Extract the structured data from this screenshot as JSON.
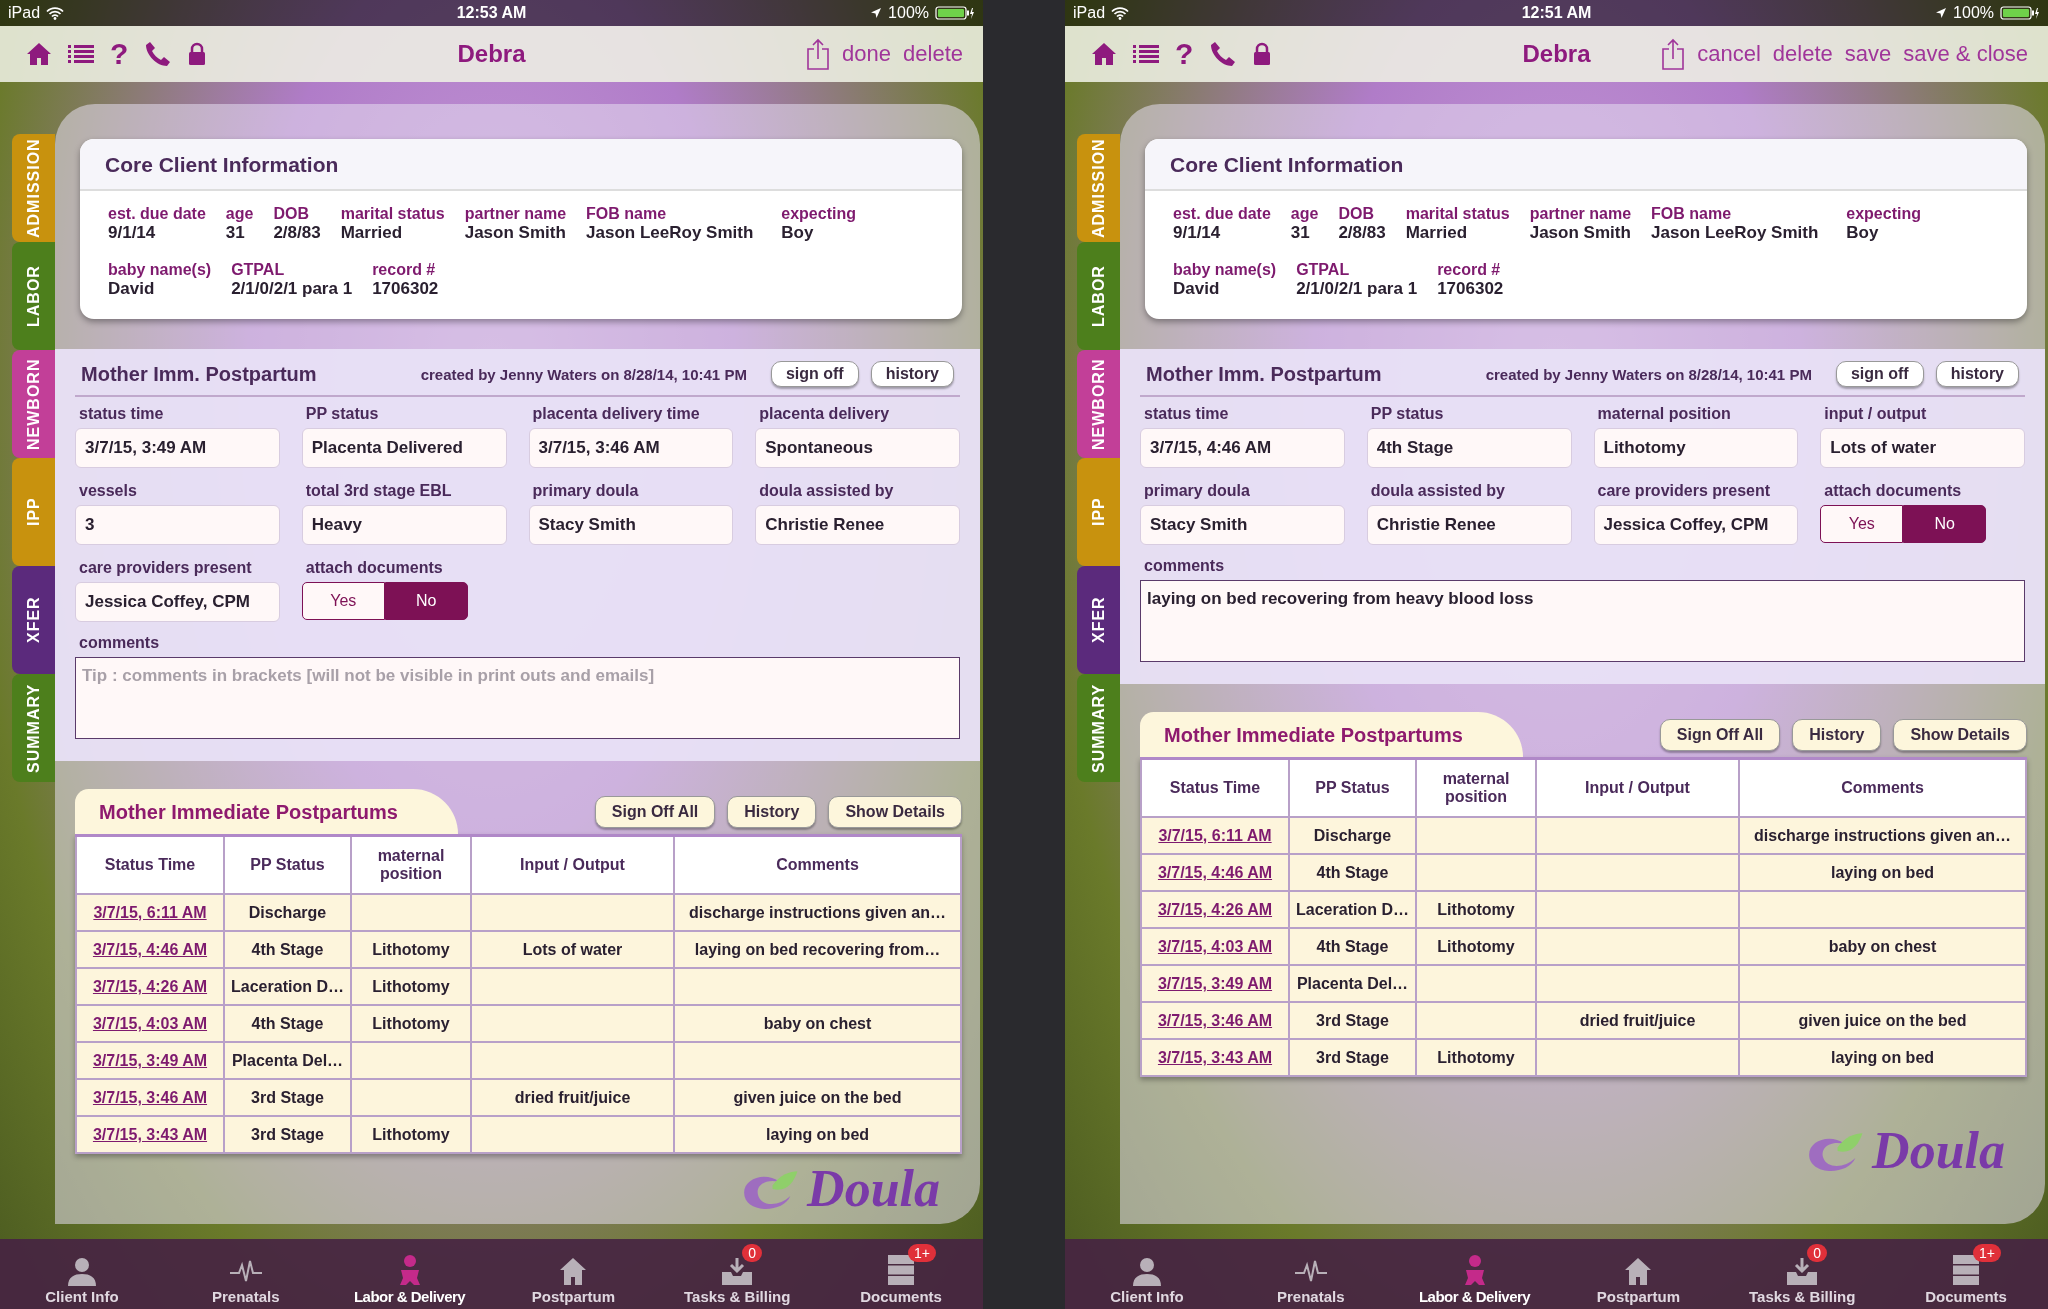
{
  "screens": [
    {
      "status_bar": {
        "carrier": "iPad",
        "time": "12:53 AM",
        "battery": "100%"
      },
      "nav": {
        "help": "?",
        "title": "Debra",
        "actions": [
          "done",
          "delete"
        ]
      },
      "side_tabs": [
        {
          "label": "ADMISSION",
          "color": "#c8920e"
        },
        {
          "label": "LABOR",
          "color": "#4d7f1c"
        },
        {
          "label": "NEWBORN",
          "color": "#c23f98"
        },
        {
          "label": "IPP",
          "color": "#c8920e"
        },
        {
          "label": "XFER",
          "color": "#5b2a7c"
        },
        {
          "label": "SUMMARY",
          "color": "#4d7f1c"
        }
      ],
      "core": {
        "title": "Core Client Information",
        "rows": [
          {
            "fields": [
              {
                "label": "est. due date",
                "value": "9/1/14"
              },
              {
                "label": "age",
                "value": "31"
              },
              {
                "label": "DOB",
                "value": "2/8/83"
              },
              {
                "label": "marital status",
                "value": "Married"
              },
              {
                "label": "partner name",
                "value": "Jason Smith"
              },
              {
                "label": "FOB name",
                "value": "Jason LeeRoy Smith"
              },
              {
                "label": "expecting",
                "value": "Boy"
              }
            ]
          },
          {
            "fields": [
              {
                "label": "baby name(s)",
                "value": "David"
              },
              {
                "label": "GTPAL",
                "value": "2/1/0/2/1 para 1"
              },
              {
                "label": "record #",
                "value": "1706302"
              }
            ]
          }
        ]
      },
      "record": {
        "title": "Mother Imm. Postpartum",
        "created": "created by Jenny Waters on 8/28/14, 10:41 PM",
        "buttons": [
          "sign off",
          "history"
        ],
        "fields": [
          {
            "kind": "text",
            "label": "status time",
            "value": "3/7/15, 3:49 AM"
          },
          {
            "kind": "text",
            "label": "PP status",
            "value": "Placenta Delivered"
          },
          {
            "kind": "text",
            "label": "placenta delivery time",
            "value": "3/7/15, 3:46 AM"
          },
          {
            "kind": "text",
            "label": "placenta delivery",
            "value": "Spontaneous"
          },
          {
            "kind": "text",
            "label": "vessels",
            "value": "3"
          },
          {
            "kind": "text",
            "label": "total 3rd stage EBL",
            "value": "Heavy"
          },
          {
            "kind": "text",
            "label": "primary doula",
            "value": "Stacy Smith"
          },
          {
            "kind": "text",
            "label": "doula assisted by",
            "value": "Christie Renee"
          },
          {
            "kind": "text",
            "label": "care providers present",
            "value": "Jessica Coffey, CPM"
          },
          {
            "kind": "toggle",
            "label": "attach documents",
            "options": [
              {
                "label": "Yes",
                "selected": false
              },
              {
                "label": "No",
                "selected": true
              }
            ]
          }
        ],
        "comments": {
          "label": "comments",
          "placeholder": "Tip : comments in brackets [will not be visible in print outs and emails]"
        }
      },
      "list": {
        "title": "Mother Immediate Postpartums",
        "buttons": [
          "Sign Off All",
          "History",
          "Show Details"
        ],
        "columns": [
          "Status Time",
          "PP Status",
          "maternal position",
          "Input / Output",
          "Comments"
        ],
        "rows": [
          {
            "status_time": "3/7/15, 6:11 AM",
            "pp_status": "Discharge",
            "comments": "discharge instructions given an…"
          },
          {
            "status_time": "3/7/15, 4:46 AM",
            "pp_status": "4th Stage",
            "maternal_position": "Lithotomy",
            "input_output": "Lots of water",
            "comments": "laying on bed recovering from…"
          },
          {
            "status_time": "3/7/15, 4:26 AM",
            "pp_status": "Laceration D…",
            "maternal_position": "Lithotomy"
          },
          {
            "status_time": "3/7/15, 4:03 AM",
            "pp_status": "4th Stage",
            "maternal_position": "Lithotomy",
            "comments": "baby on chest"
          },
          {
            "status_time": "3/7/15, 3:49 AM",
            "pp_status": "Placenta Del…"
          },
          {
            "status_time": "3/7/15, 3:46 AM",
            "pp_status": "3rd Stage",
            "input_output": "dried fruit/juice",
            "comments": "given juice on the bed"
          },
          {
            "status_time": "3/7/15, 3:43 AM",
            "pp_status": "3rd Stage",
            "maternal_position": "Lithotomy",
            "comments": "laying on bed"
          }
        ]
      },
      "logo": "Doula",
      "tab_bar": [
        {
          "label": "Client Info",
          "selected": false
        },
        {
          "label": "Prenatals",
          "selected": false
        },
        {
          "label": "Labor & Delivery",
          "selected": true
        },
        {
          "label": "Postpartum",
          "selected": false
        },
        {
          "label": "Tasks & Billing",
          "selected": false,
          "badge": "0"
        },
        {
          "label": "Documents",
          "selected": false,
          "badge": "1+"
        }
      ]
    },
    {
      "status_bar": {
        "carrier": "iPad",
        "time": "12:51 AM",
        "battery": "100%"
      },
      "nav": {
        "help": "?",
        "title": "Debra",
        "actions": [
          "cancel",
          "delete",
          "save",
          "save & close"
        ]
      },
      "side_tabs": [
        {
          "label": "ADMISSION",
          "color": "#c8920e"
        },
        {
          "label": "LABOR",
          "color": "#4d7f1c"
        },
        {
          "label": "NEWBORN",
          "color": "#c23f98"
        },
        {
          "label": "IPP",
          "color": "#c8920e"
        },
        {
          "label": "XFER",
          "color": "#5b2a7c"
        },
        {
          "label": "SUMMARY",
          "color": "#4d7f1c"
        }
      ],
      "core": {
        "title": "Core Client Information",
        "rows": [
          {
            "fields": [
              {
                "label": "est. due date",
                "value": "9/1/14"
              },
              {
                "label": "age",
                "value": "31"
              },
              {
                "label": "DOB",
                "value": "2/8/83"
              },
              {
                "label": "marital status",
                "value": "Married"
              },
              {
                "label": "partner name",
                "value": "Jason Smith"
              },
              {
                "label": "FOB name",
                "value": "Jason LeeRoy Smith"
              },
              {
                "label": "expecting",
                "value": "Boy"
              }
            ]
          },
          {
            "fields": [
              {
                "label": "baby name(s)",
                "value": "David"
              },
              {
                "label": "GTPAL",
                "value": "2/1/0/2/1 para 1"
              },
              {
                "label": "record #",
                "value": "1706302"
              }
            ]
          }
        ]
      },
      "record": {
        "title": "Mother Imm. Postpartum",
        "created": "created by Jenny Waters on 8/28/14, 10:41 PM",
        "buttons": [
          "sign off",
          "history"
        ],
        "fields": [
          {
            "kind": "text",
            "label": "status time",
            "value": "3/7/15, 4:46 AM"
          },
          {
            "kind": "text",
            "label": "PP status",
            "value": "4th Stage"
          },
          {
            "kind": "text",
            "label": "maternal position",
            "value": "Lithotomy"
          },
          {
            "kind": "text",
            "label": "input / output",
            "value": "Lots of water"
          },
          {
            "kind": "text",
            "label": "primary doula",
            "value": "Stacy Smith"
          },
          {
            "kind": "text",
            "label": "doula assisted by",
            "value": "Christie Renee"
          },
          {
            "kind": "text",
            "label": "care providers present",
            "value": "Jessica Coffey, CPM"
          },
          {
            "kind": "toggle",
            "label": "attach documents",
            "options": [
              {
                "label": "Yes",
                "selected": false
              },
              {
                "label": "No",
                "selected": true
              }
            ]
          }
        ],
        "comments": {
          "label": "comments",
          "value": "laying on bed recovering from heavy blood loss"
        }
      },
      "list": {
        "title": "Mother Immediate Postpartums",
        "buttons": [
          "Sign Off All",
          "History",
          "Show Details"
        ],
        "columns": [
          "Status Time",
          "PP Status",
          "maternal position",
          "Input / Output",
          "Comments"
        ],
        "rows": [
          {
            "status_time": "3/7/15, 6:11 AM",
            "pp_status": "Discharge",
            "comments": "discharge instructions given an…"
          },
          {
            "status_time": "3/7/15, 4:46 AM",
            "pp_status": "4th Stage",
            "comments": "laying on bed"
          },
          {
            "status_time": "3/7/15, 4:26 AM",
            "pp_status": "Laceration D…",
            "maternal_position": "Lithotomy"
          },
          {
            "status_time": "3/7/15, 4:03 AM",
            "pp_status": "4th Stage",
            "maternal_position": "Lithotomy",
            "comments": "baby on chest"
          },
          {
            "status_time": "3/7/15, 3:49 AM",
            "pp_status": "Placenta Del…"
          },
          {
            "status_time": "3/7/15, 3:46 AM",
            "pp_status": "3rd Stage",
            "input_output": "dried fruit/juice",
            "comments": "given juice on the bed"
          },
          {
            "status_time": "3/7/15, 3:43 AM",
            "pp_status": "3rd Stage",
            "maternal_position": "Lithotomy",
            "comments": "laying on bed"
          }
        ]
      },
      "logo": "Doula",
      "tab_bar": [
        {
          "label": "Client Info",
          "selected": false
        },
        {
          "label": "Prenatals",
          "selected": false
        },
        {
          "label": "Labor & Delivery",
          "selected": true
        },
        {
          "label": "Postpartum",
          "selected": false
        },
        {
          "label": "Tasks & Billing",
          "selected": false,
          "badge": "0"
        },
        {
          "label": "Documents",
          "selected": false,
          "badge": "1+"
        }
      ]
    }
  ]
}
